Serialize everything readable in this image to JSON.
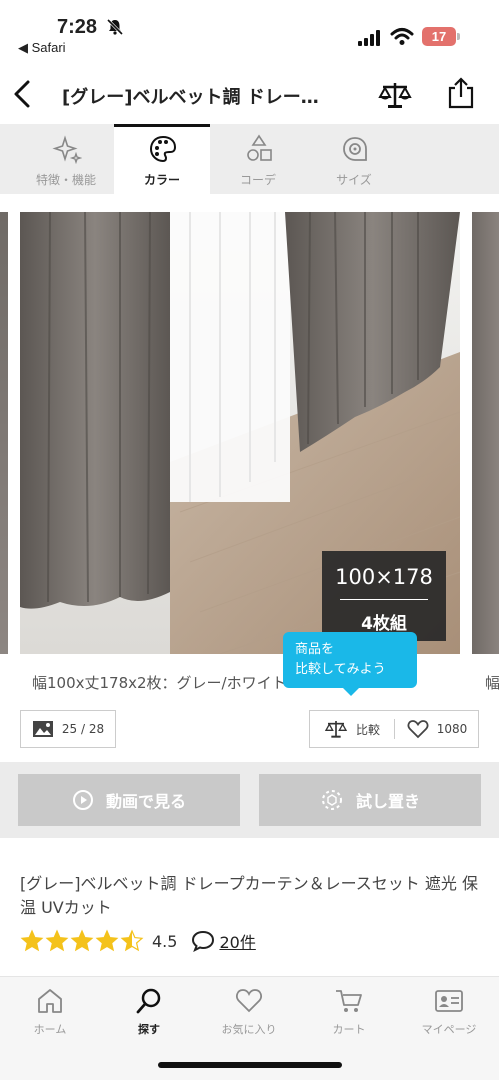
{
  "status_bar": {
    "time": "7:28",
    "back_app": "◀ Safari",
    "battery": "17",
    "battery_color": "#e3716c"
  },
  "nav": {
    "title": "[グレー]ベルベット調 ドレー…",
    "icons": [
      "back-chevron-icon",
      "compare-scale-icon",
      "share-icon"
    ]
  },
  "tabs": [
    {
      "label": "特徴・機能",
      "icon": "sparkle-icon",
      "active": false
    },
    {
      "label": "カラー",
      "icon": "palette-icon",
      "active": true
    },
    {
      "label": "コーデ",
      "icon": "shapes-icon",
      "active": false
    },
    {
      "label": "サイズ",
      "icon": "tape-measure-icon",
      "active": false
    }
  ],
  "gallery": {
    "size_badge": "100×178",
    "set_badge": "4枚組",
    "caption": "幅100x丈178x2枚：グレー/ホワイト",
    "caption_next": "幅",
    "tooltip_line1": "商品を",
    "tooltip_line2": "比較してみよう",
    "tooltip_color": "#1ab8e8",
    "image_counter": "25 / 28",
    "compare_label": "比較",
    "like_count": "1080"
  },
  "buttons": {
    "video": "動画で見る",
    "try_place": "試し置き"
  },
  "product": {
    "name": "[グレー]ベルベット調 ドレープカーテン＆レースセット 遮光 保温 UVカット",
    "rating_value": "4.5",
    "rating": 4.5,
    "reviews": "20件",
    "star_color": "#f4c21b"
  },
  "bottom_nav": [
    {
      "label": "ホーム",
      "icon": "home-icon",
      "active": false
    },
    {
      "label": "探す",
      "icon": "search-icon",
      "active": true
    },
    {
      "label": "お気に入り",
      "icon": "heart-icon",
      "active": false
    },
    {
      "label": "カート",
      "icon": "cart-icon",
      "active": false
    },
    {
      "label": "マイページ",
      "icon": "member-card-icon",
      "active": false
    }
  ]
}
